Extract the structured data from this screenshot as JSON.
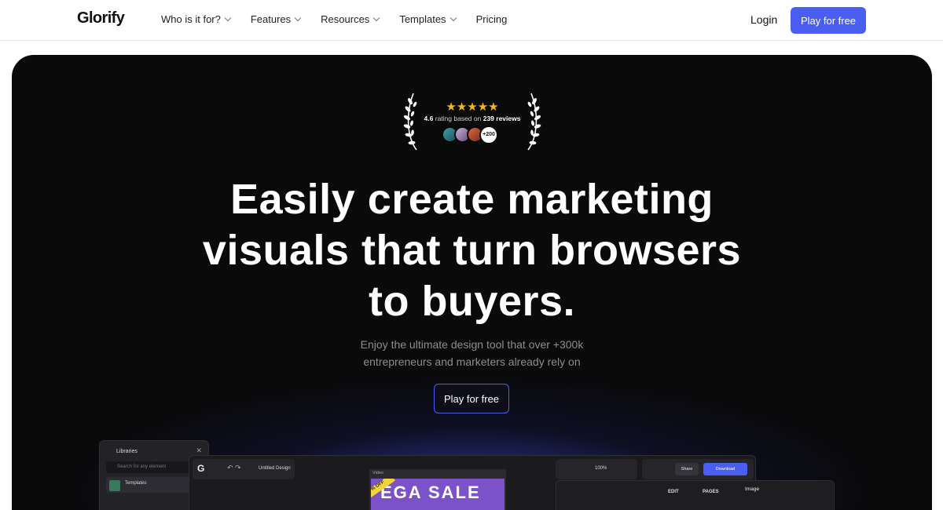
{
  "nav": {
    "logo": "Glorify",
    "items": [
      {
        "label": "Who is it for?",
        "dropdown": true
      },
      {
        "label": "Features",
        "dropdown": true
      },
      {
        "label": "Resources",
        "dropdown": true
      },
      {
        "label": "Templates",
        "dropdown": true
      },
      {
        "label": "Pricing",
        "dropdown": false
      }
    ],
    "login": "Login",
    "cta": "Play for free"
  },
  "rating": {
    "stars": "★★★★★",
    "score": "4.6",
    "text_mid": "rating based on",
    "reviews": "239 reviews",
    "more_avatars": "+200"
  },
  "hero": {
    "headline_lines": [
      "Easily create marketing",
      "visuals that turn browsers",
      "to buyers."
    ],
    "sub_lines": [
      "Enjoy the ultimate design tool that over +300k",
      "entrepreneurs and marketers already rely on"
    ],
    "cta": "Play for free"
  },
  "editor": {
    "libraries_title": "Libraries",
    "search_placeholder": "Search for any element",
    "templates_label": "Templates",
    "design_name": "Untitled Design",
    "zoom": "100%",
    "share": "Share",
    "download": "Download",
    "canvas_label": "Video",
    "sale_text": "EGA SALE",
    "sale_badge": "% OFF",
    "panel_tabs": [
      "EDIT",
      "PAGES"
    ],
    "panel_image": "Image"
  },
  "colors": {
    "accent": "#4b5ef2",
    "star": "#f5b819",
    "hero_bg": "#0a0a0b"
  }
}
